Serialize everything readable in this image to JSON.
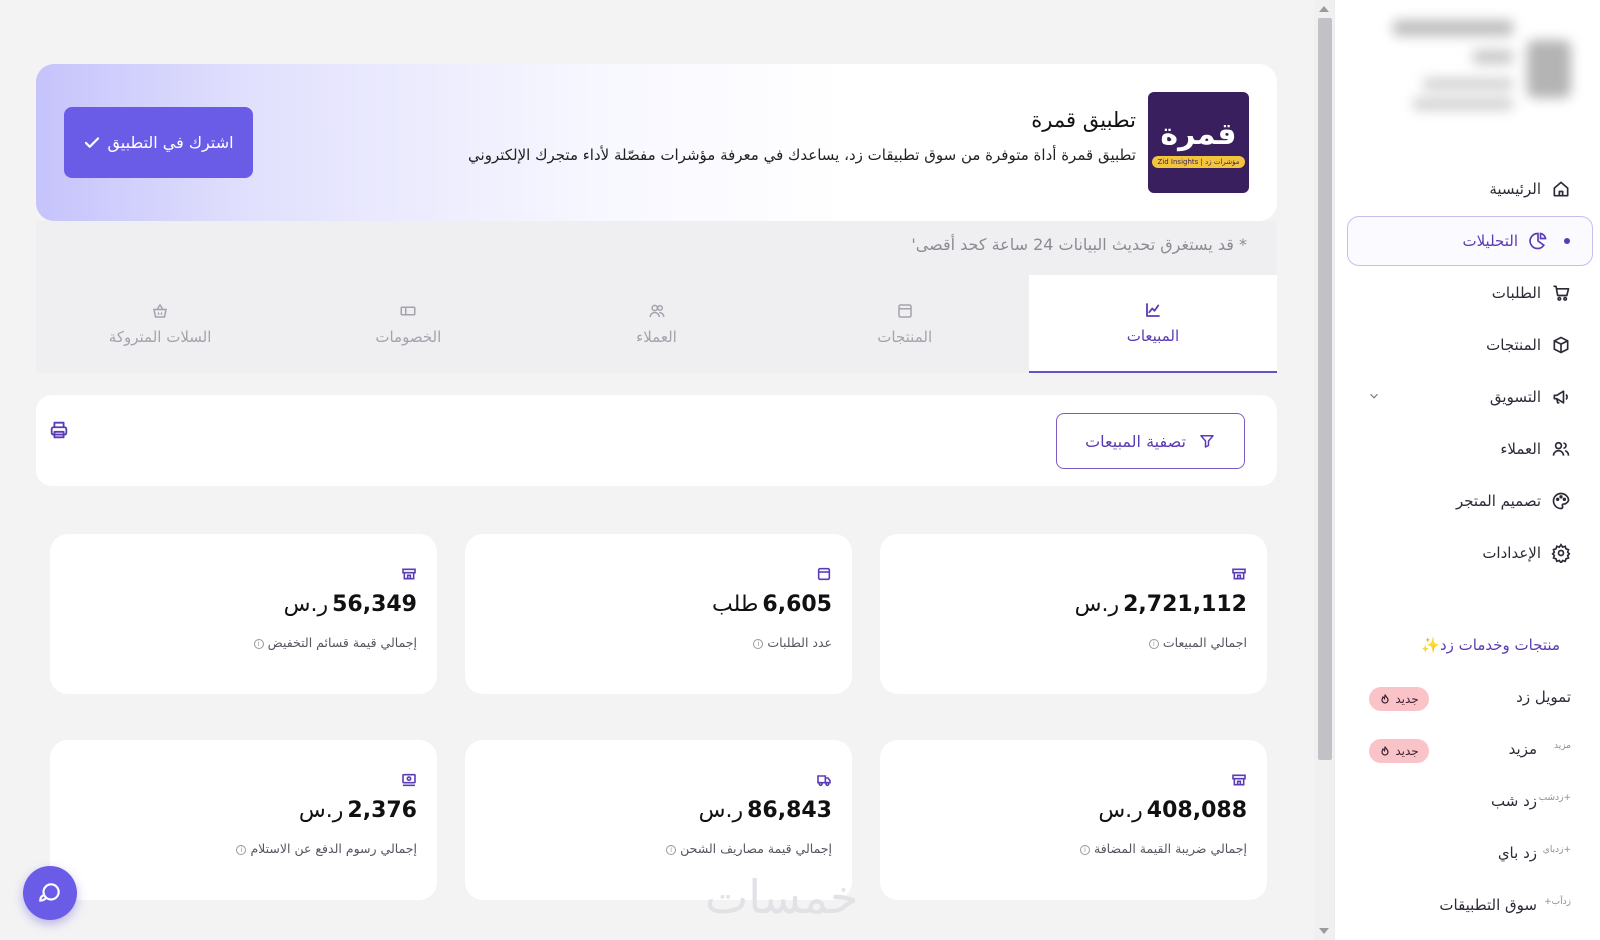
{
  "hero": {
    "logo_glyph": "قمرة",
    "logo_tag": "Zid Insights | مؤشرات زد",
    "title": "تطبيق قمرة",
    "description": "تطبيق قمرة أداة متوفرة من سوق تطبيقات زد، يساعدك في معرفة مؤشرات مفصّلة لأداء متجرك الإلكتروني",
    "subscribe_label": "اشترك في التطبيق"
  },
  "note": "* قد يستغرق تحديث البيانات 24 ساعة كحد أقصى'",
  "tabs": [
    {
      "label": "السلات المتروكة",
      "icon": "basket-icon",
      "active": false
    },
    {
      "label": "الخصومات",
      "icon": "coupon-icon",
      "active": false
    },
    {
      "label": "العملاء",
      "icon": "users-icon",
      "active": false
    },
    {
      "label": "المنتجات",
      "icon": "box-icon",
      "active": false
    },
    {
      "label": "المبيعات",
      "icon": "chart-line-icon",
      "active": true
    }
  ],
  "filter": {
    "label": "تصفية المبيعات"
  },
  "cards": [
    {
      "value": "2,721,112",
      "unit": "ر.س",
      "label": "اجمالي المبيعات",
      "icon": "store-icon"
    },
    {
      "value": "6,605",
      "unit": "طلب",
      "label": "عدد الطلبات",
      "icon": "order-icon"
    },
    {
      "value": "56,349",
      "unit": "ر.س",
      "label": "إجمالي قيمة قسائم التخفيض",
      "icon": "store-icon"
    },
    {
      "value": "408,088",
      "unit": "ر.س",
      "label": "إجمالي ضريبة القيمة المضافة",
      "icon": "store-icon"
    },
    {
      "value": "86,843",
      "unit": "ر.س",
      "label": "إجمالي قيمة مصاريف الشحن",
      "icon": "truck-icon"
    },
    {
      "value": "2,376",
      "unit": "ر.س",
      "label": "إجمالي رسوم الدفع عن الاستلام",
      "icon": "cash-icon"
    }
  ],
  "watermark": "خمسات",
  "sidebar": {
    "nav": [
      {
        "label": "الرئيسية",
        "icon": "home-icon"
      },
      {
        "label": "التحليلات",
        "icon": "analytics-icon",
        "active": true
      },
      {
        "label": "الطلبات",
        "icon": "cart-icon"
      },
      {
        "label": "المنتجات",
        "icon": "package-icon"
      },
      {
        "label": "التسويق",
        "icon": "megaphone-icon"
      },
      {
        "label": "العملاء",
        "icon": "users-icon"
      },
      {
        "label": "تصميم المتجر",
        "icon": "palette-icon"
      },
      {
        "label": "الإعدادات",
        "icon": "gear-icon"
      }
    ],
    "services_title": "منتجات وخدمات زد✨",
    "services": [
      {
        "label": "تمويل زد",
        "badge": "جديد"
      },
      {
        "label": "مزيد",
        "mini": "مزيد",
        "badge": "جديد"
      },
      {
        "label": "زد شب",
        "mini": "زدشب+"
      },
      {
        "label": "زد باي",
        "mini": "زدباي+"
      },
      {
        "label": "سوق التطبيقات",
        "mini": "+زدآب"
      }
    ]
  },
  "colors": {
    "accent": "#6b5ce7",
    "brand_purple": "#5b3bb5",
    "badge_pink": "#f9c3c7"
  }
}
